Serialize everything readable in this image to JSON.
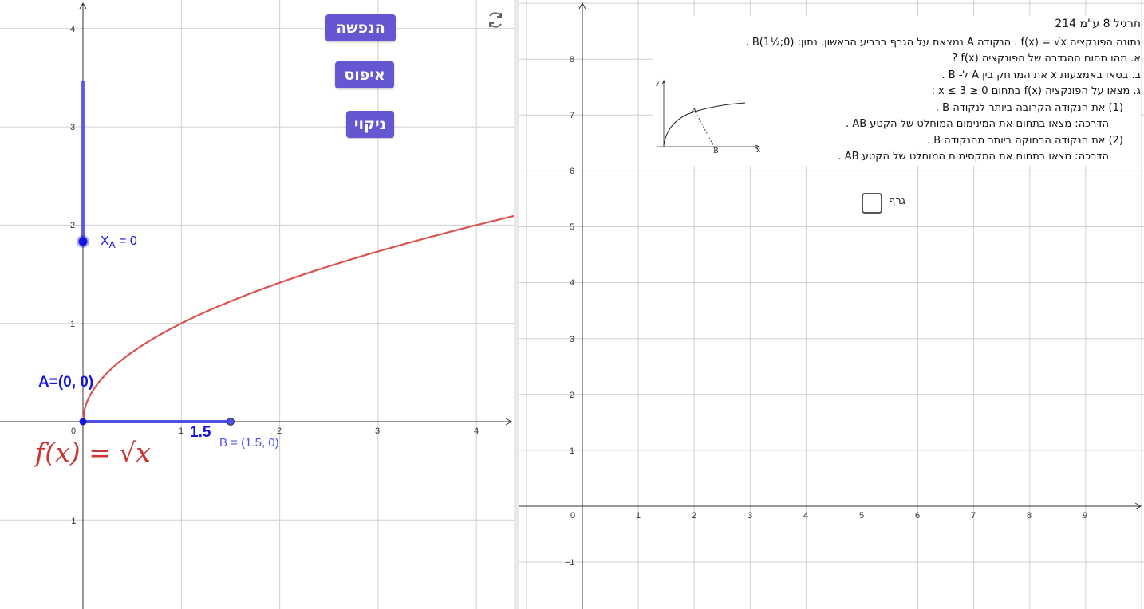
{
  "left_panel": {
    "buttons": {
      "reveal": "הנפשה",
      "reset": "איפוס",
      "clear": "ניקוי"
    },
    "refresh_icon": "refresh-icon",
    "point_a_label": "A=(0, 0)",
    "xa_label_prefix": "X",
    "xa_label_sub": "A",
    "xa_label_suffix": " = 0",
    "segment_value": "1.5",
    "point_b_label": "B = (1.5, 0)",
    "function_label": "f(x) = √x",
    "x_ticks": [
      "0",
      "1",
      "2",
      "3",
      "4"
    ],
    "y_ticks": [
      "4",
      "3",
      "2",
      "1",
      "−1"
    ],
    "colors": {
      "curve": "#d9534f",
      "point": "#1515e0",
      "segment": "#4f4fe8",
      "button": "#6557d2"
    }
  },
  "right_panel": {
    "task": {
      "title": "תרגיל 8 ע\"מ 214",
      "line1": "נתונה הפונקציה f(x) = √x . הנקודה A נמצאת על הגרף ברביע הראשון. נתון: B(1½;0) .",
      "line2": "א. מהו תחום ההגדרה של הפונקציה f(x) ?",
      "line3": "ב. בטאו באמצעות x את המרחק בין A ל- B .",
      "line4": "ג. מצאו על הפונקציה f(x) בתחום 0 ≤ x ≤ 3 :",
      "line5": "(1) את הנקודה הקרובה ביותר לנקודה B .",
      "line6": "הדרכה: מצאו בתחום את המינימום המוחלט של הקטע AB .",
      "line7": "(2) את הנקודה הרחוקה ביותר מהנקודה B .",
      "line8": "הדרכה: מצאו בתחום את המקסימום המוחלט של הקטע AB ."
    },
    "inset": {
      "y": "y",
      "x": "x",
      "a": "A",
      "b": "B"
    },
    "checkbox_label": "גרף",
    "checkbox_checked": false,
    "x_ticks": [
      "0",
      "1",
      "2",
      "3",
      "4",
      "5",
      "6",
      "7",
      "8",
      "9"
    ],
    "y_ticks": [
      "8",
      "7",
      "6",
      "5",
      "4",
      "3",
      "2",
      "1",
      "−1"
    ]
  }
}
